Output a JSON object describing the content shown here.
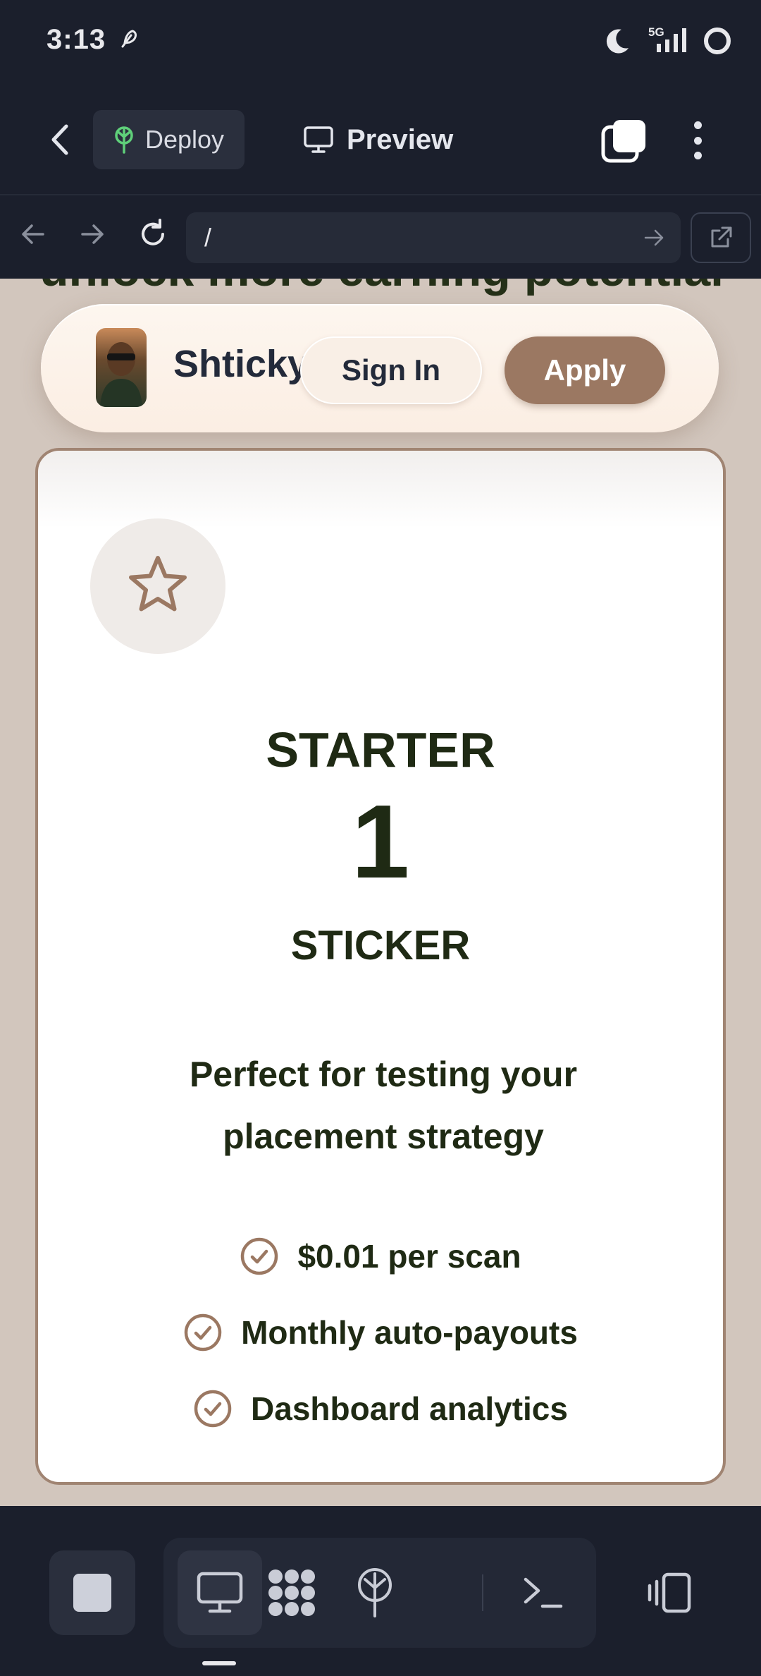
{
  "status_bar": {
    "time": "3:13",
    "network": "5G",
    "icons": [
      "feather-icon",
      "moon-icon",
      "signal-icon",
      "circle-icon"
    ]
  },
  "toolbar": {
    "deploy_label": "Deploy",
    "preview_label": "Preview",
    "icons": [
      "back-arrow-icon",
      "deploy-tree-icon",
      "monitor-icon",
      "tabs-icon",
      "more-vert-icon"
    ]
  },
  "browser": {
    "url": "/",
    "icons": [
      "arrow-left-icon",
      "arrow-right-icon",
      "reload-icon",
      "go-arrow-icon",
      "open-external-icon"
    ]
  },
  "page": {
    "behind_heading": "unlock more earning potential",
    "nav": {
      "brand": "Shticky",
      "signin_label": "Sign In",
      "apply_label": "Apply"
    },
    "plan": {
      "name": "STARTER",
      "quantity": "1",
      "unit": "STICKER",
      "description": "Perfect for testing your placement strategy",
      "features": [
        "$0.01 per scan",
        "Monthly auto-payouts",
        "Dashboard analytics"
      ]
    },
    "colors": {
      "accent": "#9b7862",
      "text_dark": "#1f2a14",
      "page_bg": "#d2c6bd",
      "chrome_bg": "#1b1f2c"
    }
  },
  "dock": {
    "icons": [
      "stop-icon",
      "desktop-icon",
      "apps-grid-icon",
      "deploy-tree-icon",
      "terminal-icon",
      "side-panel-icon"
    ]
  }
}
